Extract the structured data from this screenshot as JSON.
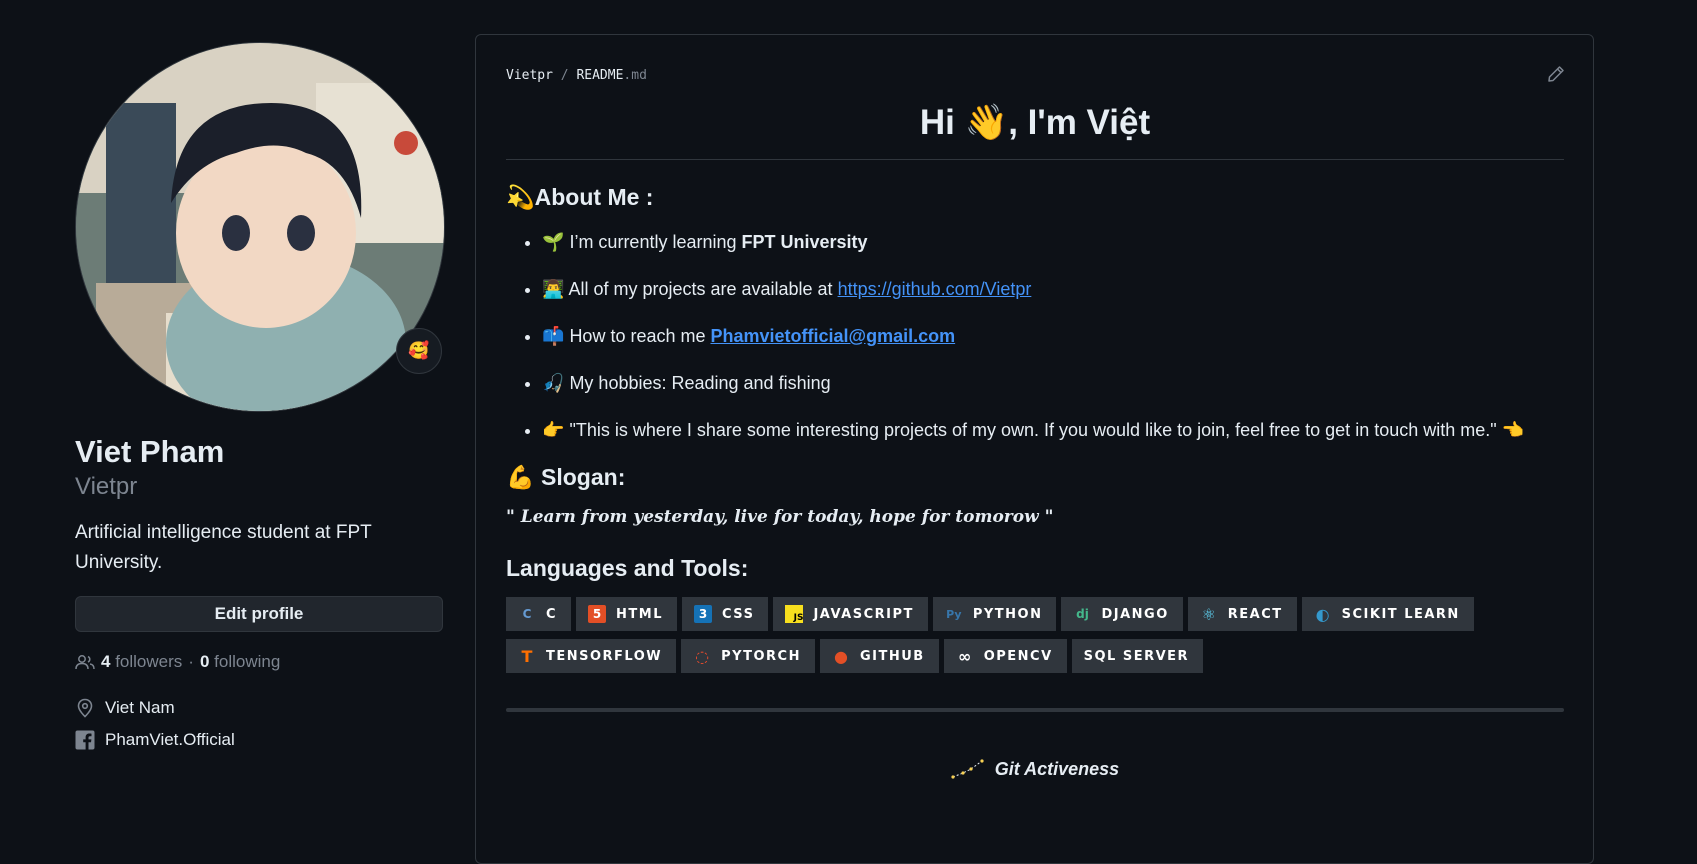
{
  "profile": {
    "fullname": "Viet Pham",
    "login": "Vietpr",
    "bio": "Artificial intelligence student at FPT University.",
    "status_emoji": "🥰",
    "edit_label": "Edit profile",
    "followers_count": "4",
    "followers_label": "followers",
    "separator": "·",
    "following_count": "0",
    "following_label": "following",
    "location": "Viet Nam",
    "facebook": "PhamViet.Official"
  },
  "readme": {
    "owner": "Vietpr",
    "slash": "/",
    "file_name": "README",
    "file_ext": ".md",
    "title_pre": "Hi ",
    "title_emoji": "👋",
    "title_post": ", I'm Việt",
    "about": {
      "emoji": "💫",
      "heading": "About Me :",
      "items": [
        {
          "emoji": "🌱",
          "text": "I’m currently learning ",
          "bold": "FPT University"
        },
        {
          "emoji": "👨‍💻",
          "text": "All of my projects are available at ",
          "link": "https://github.com/Vietpr"
        },
        {
          "emoji": "📫",
          "text": "How to reach me ",
          "link": "Phamvietofficial@gmail.com"
        },
        {
          "emoji": "🎣",
          "text": "My hobbies: Reading and fishing"
        },
        {
          "emoji": "👉",
          "text": "\"This is where I share some interesting projects of my own. If you would like to join, feel free to get in touch with me.\" ",
          "emoji_after": "👈"
        }
      ]
    },
    "slogan": {
      "emoji": "💪",
      "heading": "Slogan:",
      "open_quote": "\" ",
      "text": "Learn from yesterday, live for today, hope for tomorow",
      "close_quote": " \""
    },
    "tools": {
      "heading": "Languages and Tools:",
      "badges": [
        {
          "label": "C",
          "icon": "C",
          "color": "#659ad2"
        },
        {
          "label": "HTML",
          "icon": "5",
          "color": "#e34f26"
        },
        {
          "label": "CSS",
          "icon": "3",
          "color": "#1572b6"
        },
        {
          "label": "JAVASCRIPT",
          "icon": "JS",
          "color": "#f7df1e"
        },
        {
          "label": "PYTHON",
          "icon": "Py",
          "color": "#3776ab"
        },
        {
          "label": "DJANGO",
          "icon": "dj",
          "color": "#44b78b"
        },
        {
          "label": "REACT",
          "icon": "⚛",
          "color": "#61dafb"
        },
        {
          "label": "SCIKIT LEARN",
          "icon": "◐",
          "color": "#3499cd"
        },
        {
          "label": "TENSORFLOW",
          "icon": "T",
          "color": "#ff6f00"
        },
        {
          "label": "PYTORCH",
          "icon": "◌",
          "color": "#ee4c2c"
        },
        {
          "label": "GITHUB",
          "icon": "●",
          "color": "#e34f26"
        },
        {
          "label": "OPENCV",
          "icon": "∞",
          "color": "#ffffff"
        },
        {
          "label": "SQL SERVER",
          "icon": "",
          "color": "#cc2927"
        }
      ]
    },
    "git": {
      "emoji": "✨",
      "label": "Git Activeness"
    }
  }
}
